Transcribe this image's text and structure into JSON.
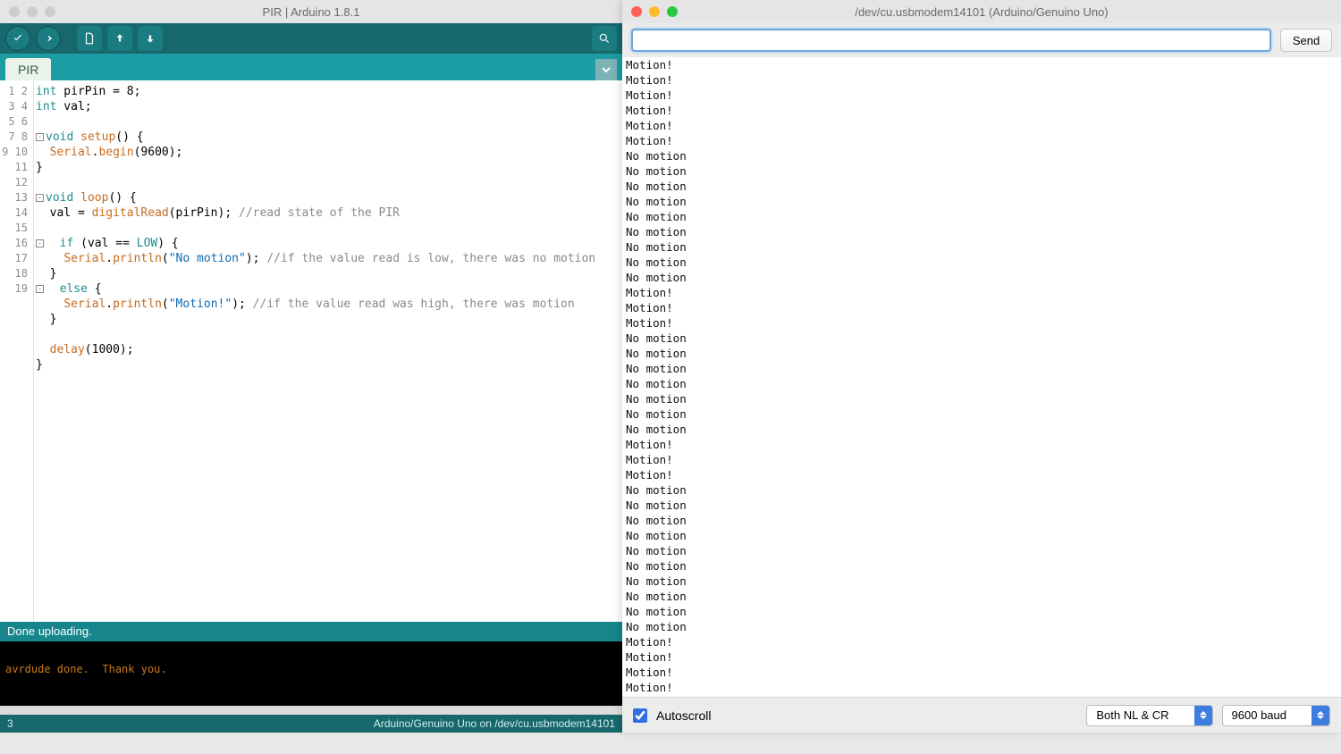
{
  "ide": {
    "title": "PIR | Arduino 1.8.1",
    "tab": "PIR",
    "status": "Done uploading.",
    "console": "avrdude done.  Thank you.",
    "bottom_left": "3",
    "bottom_right": "Arduino/Genuino Uno on /dev/cu.usbmodem14101",
    "code_lines": [
      {
        "n": 1,
        "fold": "",
        "raw": "int pirPin = 8;",
        "html": "<span class='kw'>int</span> pirPin = 8;"
      },
      {
        "n": 2,
        "fold": "",
        "raw": "int val;",
        "html": "<span class='kw'>int</span> val;"
      },
      {
        "n": 3,
        "fold": "",
        "raw": "",
        "html": ""
      },
      {
        "n": 4,
        "fold": "-",
        "raw": "void setup() {",
        "html": "<span class='kw'>void</span> <span class='fn'>setup</span>() {"
      },
      {
        "n": 5,
        "fold": "",
        "raw": "  Serial.begin(9600);",
        "html": "  <span class='fn'>Serial</span>.<span class='fn'>begin</span>(9600);"
      },
      {
        "n": 6,
        "fold": "",
        "raw": "}",
        "html": "}"
      },
      {
        "n": 7,
        "fold": "",
        "raw": "",
        "html": ""
      },
      {
        "n": 8,
        "fold": "-",
        "raw": "void loop() {",
        "html": "<span class='kw'>void</span> <span class='fn'>loop</span>() {"
      },
      {
        "n": 9,
        "fold": "",
        "raw": "  val = digitalRead(pirPin); //read state of the PIR",
        "html": "  val = <span class='fn'>digitalRead</span>(pirPin); <span class='com'>//read state of the PIR</span>"
      },
      {
        "n": 10,
        "fold": "",
        "raw": "",
        "html": ""
      },
      {
        "n": 11,
        "fold": "-",
        "raw": "  if (val == LOW) {",
        "html": "  <span class='kw'>if</span> (val == <span class='const'>LOW</span>) {"
      },
      {
        "n": 12,
        "fold": "",
        "raw": "    Serial.println(\"No motion\"); //if the value read is low, there was no motion",
        "html": "    <span class='fn'>Serial</span>.<span class='fn'>println</span>(<span class='str'>\"No motion\"</span>); <span class='com'>//if the value read is low, there was no motion</span>"
      },
      {
        "n": 13,
        "fold": "",
        "raw": "  }",
        "html": "  }"
      },
      {
        "n": 14,
        "fold": "-",
        "raw": "  else {",
        "html": "  <span class='kw'>else</span> {"
      },
      {
        "n": 15,
        "fold": "",
        "raw": "    Serial.println(\"Motion!\"); //if the value read was high, there was motion",
        "html": "    <span class='fn'>Serial</span>.<span class='fn'>println</span>(<span class='str'>\"Motion!\"</span>); <span class='com'>//if the value read was high, there was motion</span>"
      },
      {
        "n": 16,
        "fold": "",
        "raw": "  }",
        "html": "  }"
      },
      {
        "n": 17,
        "fold": "",
        "raw": "",
        "html": ""
      },
      {
        "n": 18,
        "fold": "",
        "raw": "  delay(1000);",
        "html": "  <span class='fn'>delay</span>(1000);"
      },
      {
        "n": 19,
        "fold": "",
        "raw": "}",
        "html": "}"
      }
    ]
  },
  "monitor": {
    "title": "/dev/cu.usbmodem14101 (Arduino/Genuino Uno)",
    "send_label": "Send",
    "input_value": "",
    "autoscroll_label": "Autoscroll",
    "autoscroll_checked": true,
    "line_ending": "Both NL & CR",
    "baud": "9600 baud",
    "output": [
      "Motion!",
      "Motion!",
      "Motion!",
      "Motion!",
      "Motion!",
      "Motion!",
      "No motion",
      "No motion",
      "No motion",
      "No motion",
      "No motion",
      "No motion",
      "No motion",
      "No motion",
      "No motion",
      "Motion!",
      "Motion!",
      "Motion!",
      "No motion",
      "No motion",
      "No motion",
      "No motion",
      "No motion",
      "No motion",
      "No motion",
      "Motion!",
      "Motion!",
      "Motion!",
      "No motion",
      "No motion",
      "No motion",
      "No motion",
      "No motion",
      "No motion",
      "No motion",
      "No motion",
      "No motion",
      "No motion",
      "Motion!",
      "Motion!",
      "Motion!",
      "Motion!"
    ]
  }
}
